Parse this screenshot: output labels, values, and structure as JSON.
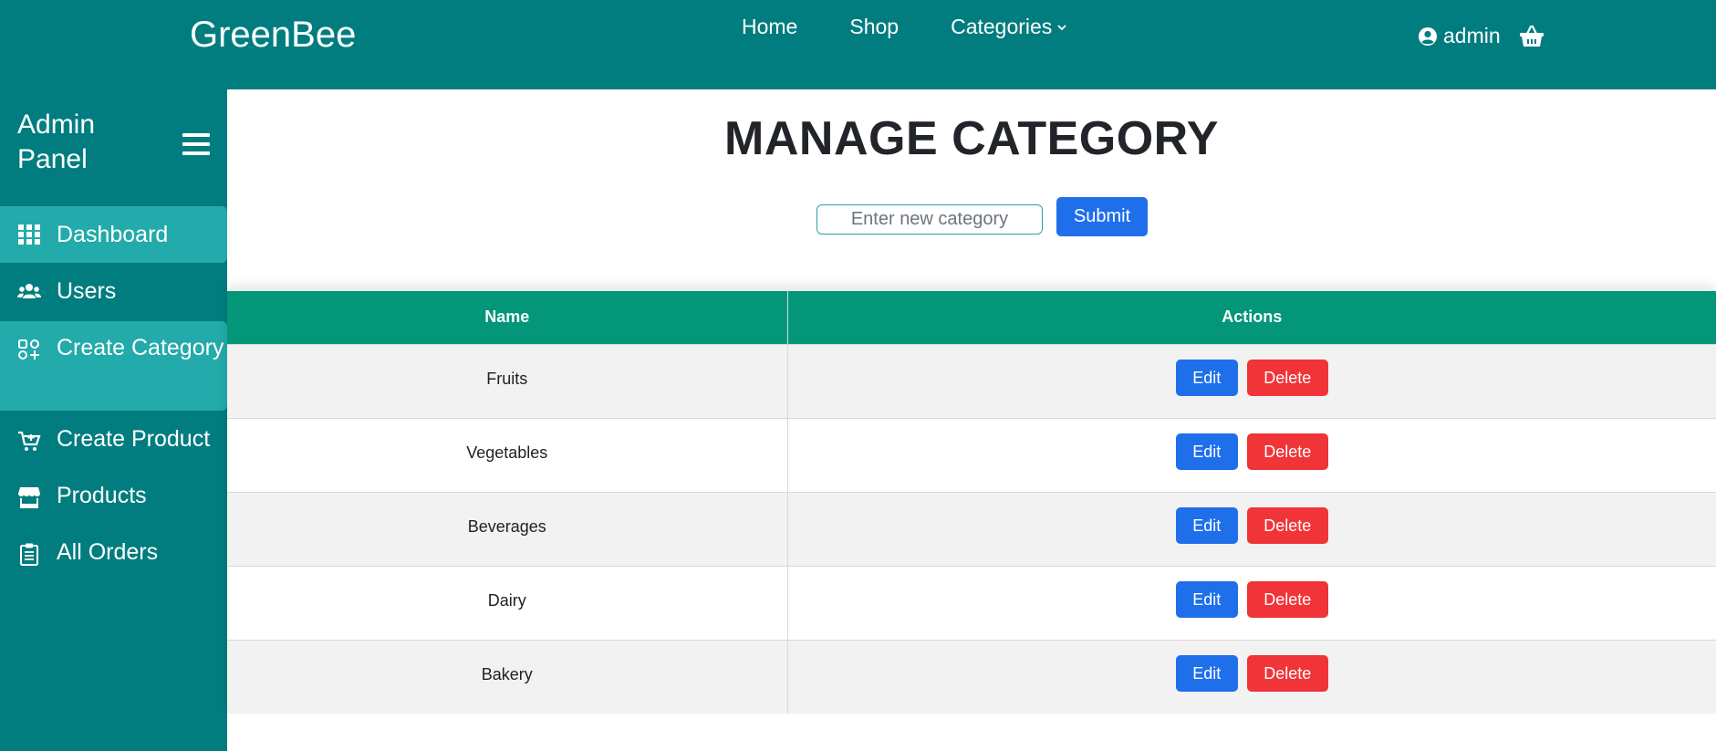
{
  "navbar": {
    "brand": "GreenBee",
    "links": [
      {
        "label": "Home"
      },
      {
        "label": "Shop"
      },
      {
        "label": "Categories"
      }
    ],
    "user": "admin"
  },
  "sidebar": {
    "title": "Admin Panel",
    "items": [
      {
        "label": "Dashboard",
        "icon": "grid-icon",
        "active": true
      },
      {
        "label": "Users",
        "icon": "users-icon",
        "active": false
      },
      {
        "label": "Create Category",
        "icon": "shapes-icon",
        "active": true
      },
      {
        "label": "Create Product",
        "icon": "cart-plus-icon",
        "active": false
      },
      {
        "label": "Products",
        "icon": "store-icon",
        "active": false
      },
      {
        "label": "All Orders",
        "icon": "clipboard-icon",
        "active": false
      }
    ]
  },
  "main": {
    "title": "MANAGE CATEGORY",
    "input_placeholder": "Enter new category",
    "submit_label": "Submit",
    "table": {
      "headers": [
        "Name",
        "Actions"
      ],
      "rows": [
        {
          "name": "Fruits"
        },
        {
          "name": "Vegetables"
        },
        {
          "name": "Beverages"
        },
        {
          "name": "Dairy"
        },
        {
          "name": "Bakery"
        }
      ],
      "edit_label": "Edit",
      "delete_label": "Delete"
    }
  },
  "colors": {
    "teal": "#017d7f",
    "active_item": "#23aaaa",
    "table_header": "#039678",
    "primary": "#1f6feb",
    "danger": "#f03438"
  }
}
